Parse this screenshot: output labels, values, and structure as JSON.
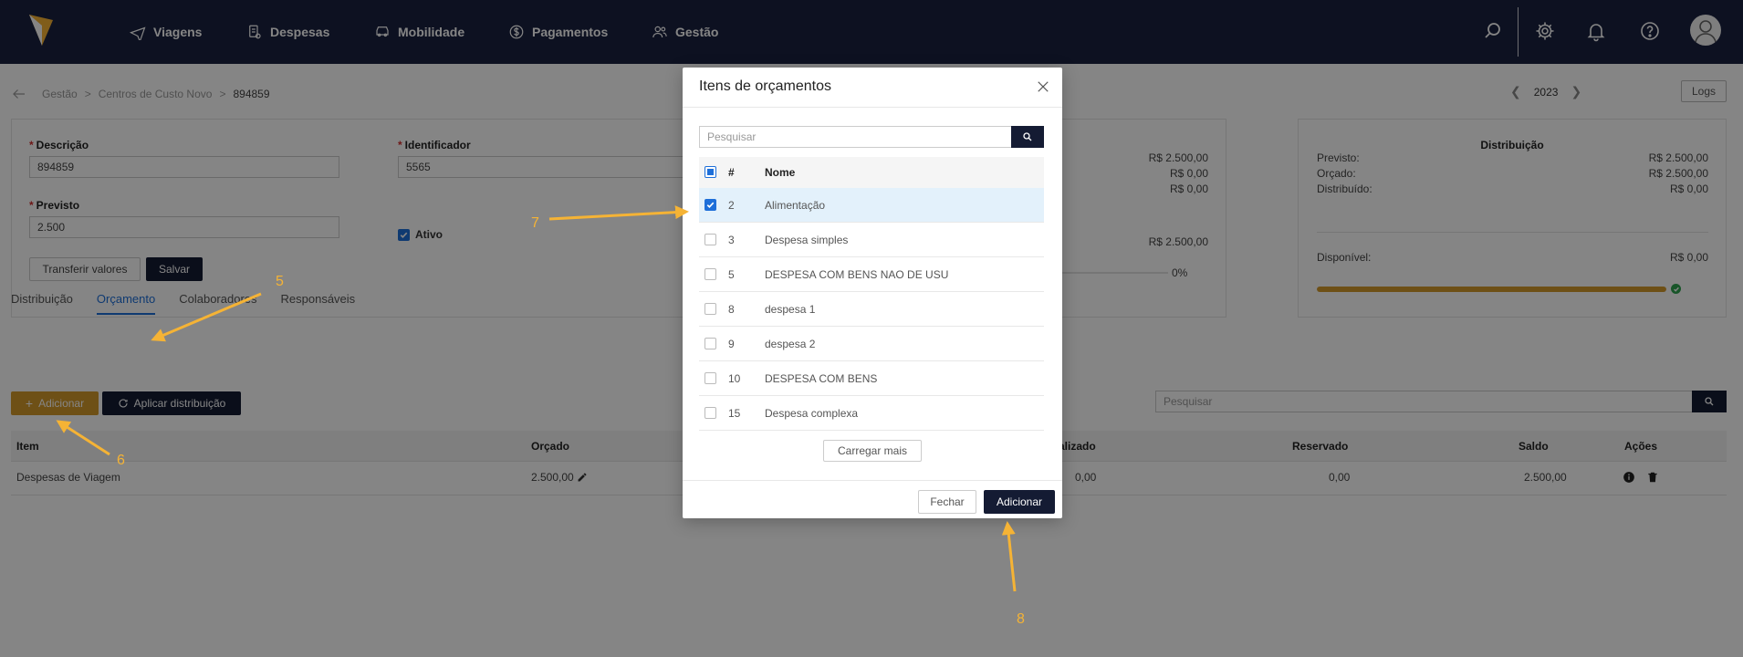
{
  "nav": {
    "items": [
      {
        "label": "Viagens",
        "icon": "plane-icon"
      },
      {
        "label": "Despesas",
        "icon": "receipt-icon"
      },
      {
        "label": "Mobilidade",
        "icon": "car-icon"
      },
      {
        "label": "Pagamentos",
        "icon": "dollar-circle-icon"
      },
      {
        "label": "Gestão",
        "icon": "users-icon"
      }
    ],
    "right_icons": [
      "search-icon",
      "gear-icon",
      "bell-icon",
      "help-circle-icon",
      "avatar-icon"
    ]
  },
  "breadcrumb": {
    "items": [
      "Gestão",
      "Centros de Custo Novo"
    ],
    "current": "894859"
  },
  "year": "2023",
  "logs_label": "Logs",
  "form": {
    "descricao_label": "Descrição",
    "descricao_value": "894859",
    "identificador_label": "Identificador",
    "identificador_value": "5565",
    "previsto_label": "Previsto",
    "previsto_value": "2.500",
    "ativo_label": "Ativo",
    "transferir_label": "Transferir valores",
    "salvar_label": "Salvar"
  },
  "summary_partial": {
    "value_1": "R$ 2.500,00",
    "value_2": "R$ 0,00",
    "value_3": "R$ 0,00",
    "value_4": "R$ 2.500,00",
    "percent": "0%"
  },
  "distribuicao_card": {
    "title": "Distribuição",
    "rows": [
      {
        "label": "Previsto:",
        "value": "R$ 2.500,00"
      },
      {
        "label": "Orçado:",
        "value": "R$ 2.500,00"
      },
      {
        "label": "Distribuído:",
        "value": "R$ 0,00"
      }
    ],
    "disponivel_label": "Disponível:",
    "disponivel_value": "R$ 0,00",
    "progress": 1.0
  },
  "tabs": [
    {
      "label": "Distribuição",
      "active": false
    },
    {
      "label": "Orçamento",
      "active": true
    },
    {
      "label": "Colaboradores",
      "active": false
    },
    {
      "label": "Responsáveis",
      "active": false
    }
  ],
  "actions": {
    "adicionar_label": "Adicionar",
    "aplicar_label": "Aplicar distribuição"
  },
  "search_placeholder": "Pesquisar",
  "table": {
    "headers": {
      "item": "Item",
      "orcado": "Orçado",
      "realizado": "alizado",
      "reservado": "Reservado",
      "saldo": "Saldo",
      "acoes": "Ações"
    },
    "row": {
      "item": "Despesas de Viagem",
      "orcado": "2.500,00",
      "realizado": "0,00",
      "reservado": "0,00",
      "saldo": "2.500,00"
    }
  },
  "modal": {
    "title": "Itens de orçamentos",
    "search_placeholder": "Pesquisar",
    "col_num": "#",
    "col_name": "Nome",
    "rows": [
      {
        "num": "2",
        "name": "Alimentação",
        "checked": true
      },
      {
        "num": "3",
        "name": "Despesa simples",
        "checked": false
      },
      {
        "num": "5",
        "name": "DESPESA COM BENS NAO DE USU",
        "checked": false
      },
      {
        "num": "8",
        "name": "despesa 1",
        "checked": false
      },
      {
        "num": "9",
        "name": "despesa 2",
        "checked": false
      },
      {
        "num": "10",
        "name": "DESPESA COM BENS",
        "checked": false
      },
      {
        "num": "15",
        "name": "Despesa complexa",
        "checked": false
      }
    ],
    "load_more_label": "Carregar mais",
    "close_label": "Fechar",
    "add_label": "Adicionar"
  },
  "annotations": [
    "5",
    "6",
    "7",
    "8"
  ],
  "colors": {
    "nav_bg": "#1a2240",
    "accent": "#d49a2b",
    "primary": "#1e6fd9",
    "dark_button": "#141b33",
    "annotation": "#f5b335"
  }
}
